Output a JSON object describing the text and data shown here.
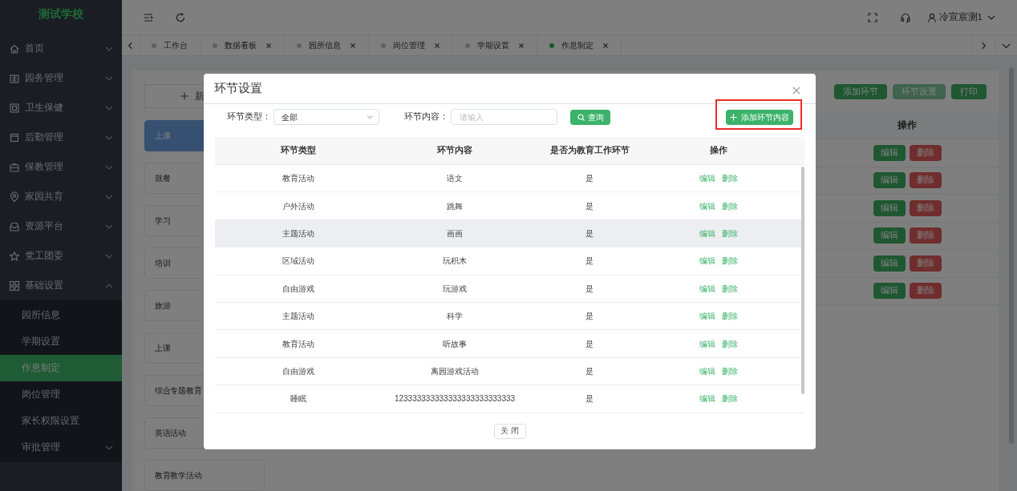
{
  "sidebar": {
    "logo": "测试学校",
    "items": [
      {
        "label": "首页",
        "expanded": false
      },
      {
        "label": "园务管理",
        "expanded": false
      },
      {
        "label": "卫生保健",
        "expanded": false
      },
      {
        "label": "后勤管理",
        "expanded": false
      },
      {
        "label": "保教管理",
        "expanded": false
      },
      {
        "label": "家园共育",
        "expanded": false
      },
      {
        "label": "资源平台",
        "expanded": false
      },
      {
        "label": "党工团委",
        "expanded": false
      },
      {
        "label": "基础设置",
        "expanded": true,
        "children": [
          {
            "label": "园所信息",
            "selected": false
          },
          {
            "label": "学期设置",
            "selected": false
          },
          {
            "label": "作息制定",
            "selected": true
          },
          {
            "label": "岗位管理",
            "selected": false
          },
          {
            "label": "家长权限设置",
            "selected": false
          },
          {
            "label": "审批管理",
            "selected": false,
            "expanded": false
          }
        ]
      }
    ]
  },
  "topbar": {
    "user": "冷宣宸测1"
  },
  "tabs": [
    {
      "label": "工作台",
      "selected": false,
      "closable": false
    },
    {
      "label": "数据看板",
      "selected": false,
      "closable": true
    },
    {
      "label": "园所信息",
      "selected": false,
      "closable": true
    },
    {
      "label": "岗位管理",
      "selected": false,
      "closable": true
    },
    {
      "label": "学期设置",
      "selected": false,
      "closable": true
    },
    {
      "label": "作息制定",
      "selected": true,
      "closable": true
    }
  ],
  "page": {
    "new_button": "新",
    "schedule_items": [
      {
        "label": "上课",
        "selected": true
      },
      {
        "label": "就餐",
        "selected": false
      },
      {
        "label": "学习",
        "selected": false
      },
      {
        "label": "培训",
        "selected": false
      },
      {
        "label": "旅游",
        "selected": false
      },
      {
        "label": "上课",
        "selected": false
      },
      {
        "label": "综合专题教育",
        "selected": false
      },
      {
        "label": "英语活动",
        "selected": false
      },
      {
        "label": "教育教学活动",
        "selected": false
      }
    ],
    "toolbar": [
      {
        "label": "添加环节",
        "disabled": false
      },
      {
        "label": "环节设置",
        "disabled": true
      },
      {
        "label": "打印",
        "disabled": false
      }
    ],
    "table": {
      "column": "操作",
      "rows": [
        {
          "actions": [
            "编辑",
            "删除"
          ]
        },
        {
          "actions": [
            "编辑",
            "删除"
          ]
        },
        {
          "actions": [
            "编辑",
            "删除"
          ]
        },
        {
          "actions": [
            "编辑",
            "删除"
          ]
        },
        {
          "actions": [
            "编辑",
            "删除"
          ]
        },
        {
          "actions": [
            "编辑",
            "删除"
          ]
        }
      ]
    }
  },
  "modal": {
    "title": "环节设置",
    "filters": [
      {
        "kind": "select",
        "label": "环节类型：",
        "value": "全部"
      },
      {
        "kind": "input",
        "label": "环节内容：",
        "placeholder": "请输入"
      }
    ],
    "query_button": "查询",
    "add_button": "添加环节内容",
    "columns": [
      "环节类型",
      "环节内容",
      "是否为教育工作环节",
      "操作"
    ],
    "rows": [
      {
        "type": "教育活动",
        "content": "语文",
        "is_education": "是",
        "actions": [
          "编辑",
          "删除"
        ],
        "hovered": false
      },
      {
        "type": "户外活动",
        "content": "跳舞",
        "is_education": "是",
        "actions": [
          "编辑",
          "删除"
        ],
        "hovered": false
      },
      {
        "type": "主题活动",
        "content": "画画",
        "is_education": "是",
        "actions": [
          "编辑",
          "删除"
        ],
        "hovered": true
      },
      {
        "type": "区域活动",
        "content": "玩积木",
        "is_education": "是",
        "actions": [
          "编辑",
          "删除"
        ],
        "hovered": false
      },
      {
        "type": "自由游戏",
        "content": "玩游戏",
        "is_education": "是",
        "actions": [
          "编辑",
          "删除"
        ],
        "hovered": false
      },
      {
        "type": "主题活动",
        "content": "科学",
        "is_education": "是",
        "actions": [
          "编辑",
          "删除"
        ],
        "hovered": false
      },
      {
        "type": "教育活动",
        "content": "听故事",
        "is_education": "是",
        "actions": [
          "编辑",
          "删除"
        ],
        "hovered": false
      },
      {
        "type": "自由游戏",
        "content": "离园游戏活动",
        "is_education": "是",
        "actions": [
          "编辑",
          "删除"
        ],
        "hovered": false
      },
      {
        "type": "睡眠",
        "content": "123333333333333333333333333",
        "is_education": "是",
        "actions": [
          "编辑",
          "删除"
        ],
        "hovered": false
      }
    ],
    "close_button": "关 闭"
  }
}
